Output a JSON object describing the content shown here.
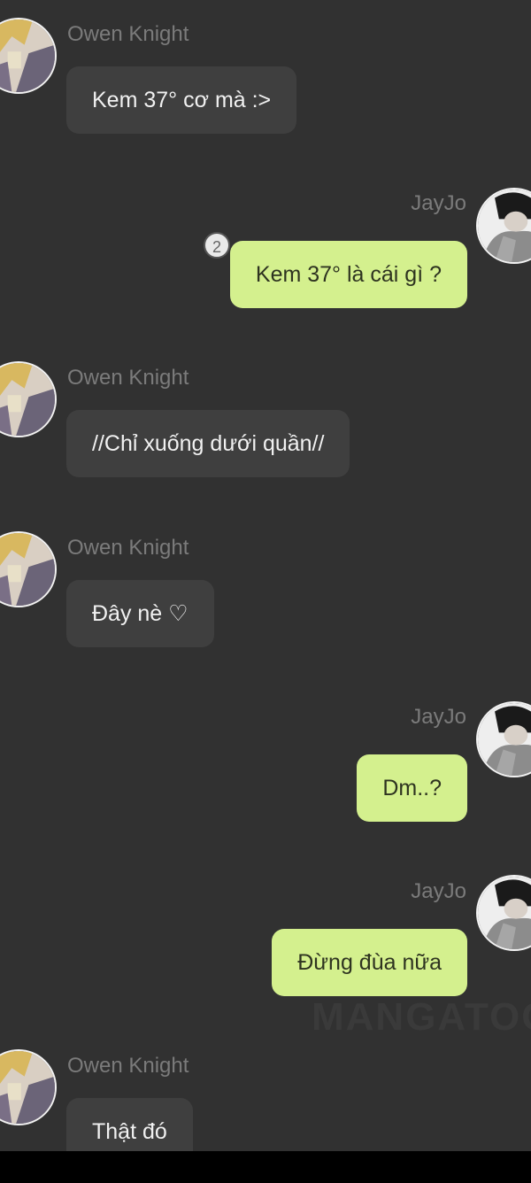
{
  "messages": [
    {
      "sender": "Owen Knight",
      "side": "left",
      "text": "Kem 37° cơ mà :>"
    },
    {
      "sender": "JayJo",
      "side": "right",
      "text": "Kem 37° là cái gì ?",
      "reply_badge": "2"
    },
    {
      "sender": "Owen Knight",
      "side": "left",
      "text": "//Chỉ xuống dưới quần//"
    },
    {
      "sender": "Owen Knight",
      "side": "left",
      "text": "Đây nè ♡"
    },
    {
      "sender": "JayJo",
      "side": "right",
      "text": "Dm..?"
    },
    {
      "sender": "JayJo",
      "side": "right",
      "text": "Đừng đùa nữa"
    },
    {
      "sender": "Owen Knight",
      "side": "left",
      "text": "Thật đó"
    }
  ],
  "watermark": "MANGATOON",
  "colors": {
    "background": "#313131",
    "left_bubble": "#3f3f3f",
    "right_bubble": "#d4f08e",
    "sender_name": "#7b7b7b"
  }
}
